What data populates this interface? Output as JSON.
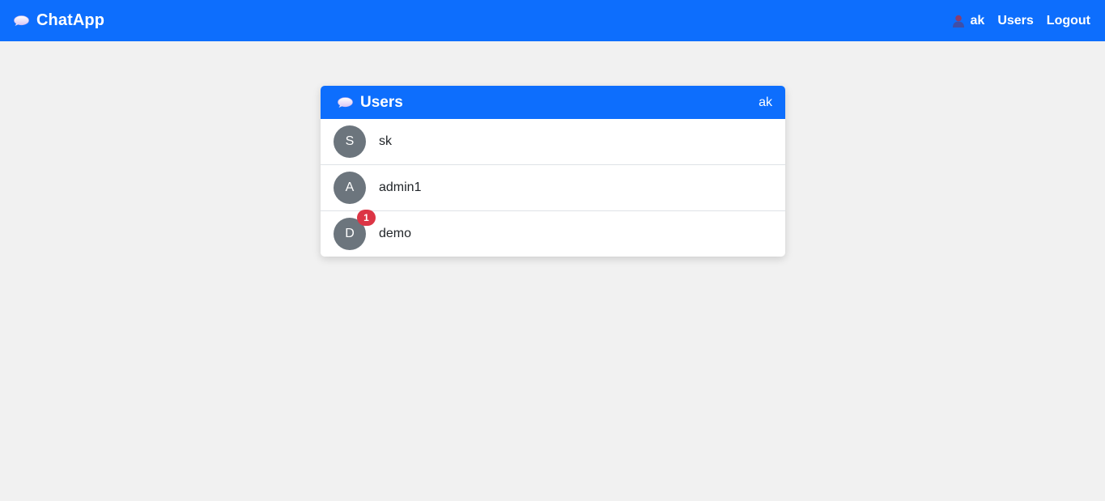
{
  "navbar": {
    "brand": "ChatApp",
    "brand_icon": "speech-bubble-icon",
    "current_user": "ak",
    "user_icon": "person-icon",
    "links": [
      "Users",
      "Logout"
    ]
  },
  "card": {
    "title": "Users",
    "title_icon": "speech-bubble-icon",
    "current_user": "ak"
  },
  "users": [
    {
      "initial": "S",
      "name": "sk",
      "unread": null
    },
    {
      "initial": "A",
      "name": "admin1",
      "unread": null
    },
    {
      "initial": "D",
      "name": "demo",
      "unread": "1"
    }
  ],
  "colors": {
    "primary": "#0d6efd",
    "avatar": "#6c757d",
    "badge": "#dc3545",
    "background": "#f1f1f1"
  }
}
